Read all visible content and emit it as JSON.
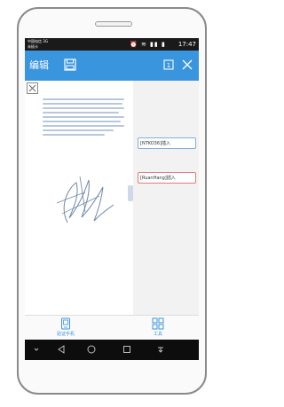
{
  "status_bar": {
    "carrier_line1": "中国电信 3G",
    "carrier_line2": "未插卡",
    "icons_text": "⏰ ≋ ▮▮ ▮",
    "time": "17:47"
  },
  "toolbar": {
    "edit_label": "编辑",
    "save_icon": "save-icon",
    "page_icon": "page-icon",
    "close_icon": "close-icon",
    "page_number": "1"
  },
  "document": {
    "fields": [
      {
        "label": "[NTKO36]插入"
      },
      {
        "label": "[RuanHang]插入"
      }
    ]
  },
  "bottom_nav": {
    "items": [
      {
        "label": "验证手机",
        "icon": "phone-verify-icon"
      },
      {
        "label": "工具",
        "icon": "tools-icon"
      }
    ]
  },
  "android_nav": {
    "buttons": [
      "chevron-down-icon",
      "back-icon",
      "home-icon",
      "recents-icon",
      "menu-icon"
    ]
  },
  "colors": {
    "accent": "#3a95df",
    "field_border": "#e57a7a",
    "status_bg": "#1a1a1a"
  }
}
